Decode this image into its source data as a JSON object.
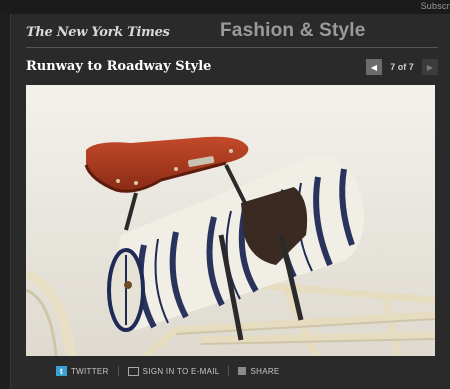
{
  "header": {
    "subscribe_label": "Subscri",
    "logo_text": "The New York Times",
    "section_title": "Fashion & Style"
  },
  "slideshow": {
    "title": "Runway to Roadway Style",
    "prev_icon": "prev-arrow-icon",
    "next_icon": "next-arrow-icon",
    "counter": "7 of 7"
  },
  "photo": {
    "subject": "bicycle-seat-with-striped-bag",
    "colors": {
      "background": "#ece9e2",
      "saddle": "#a9381f",
      "stripe": "#1f2a55",
      "canvas": "#f1eee6",
      "frame": "#eae0c4"
    }
  },
  "footer": {
    "twitter_label": "TWITTER",
    "email_label": "SIGN IN TO E-MAIL",
    "share_label": "SHARE"
  }
}
